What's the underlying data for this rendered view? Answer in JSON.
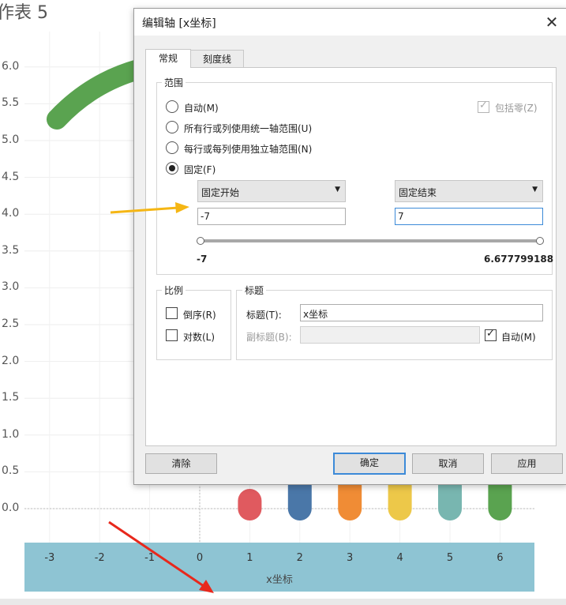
{
  "sheet": {
    "title": "作表 5"
  },
  "chart_data": {
    "type": "line",
    "y_ticks": [
      "6.0",
      "5.5",
      "5.0",
      "4.5",
      "4.0",
      "3.5",
      "3.0",
      "2.5",
      "2.0",
      "1.5",
      "1.0",
      "0.5",
      "0.0"
    ],
    "x_ticks": [
      "-3",
      "-2",
      "-1",
      "0",
      "1",
      "2",
      "3",
      "4",
      "5",
      "6"
    ],
    "xlabel": "x坐标",
    "x": [
      1,
      2,
      3,
      4,
      5,
      6
    ],
    "values": [
      0,
      0,
      0,
      0,
      0,
      0
    ],
    "colors": [
      "#e05a5f",
      "#4a77a8",
      "#f08c35",
      "#edc849",
      "#78b6b0",
      "#5aa350"
    ],
    "curve_color": "#5aa350",
    "axis_band_color": "#8ec4d3"
  },
  "dialog": {
    "title": "编辑轴 [x坐标]",
    "close_glyph": "✕",
    "tabs": [
      {
        "label": "常规",
        "active": true
      },
      {
        "label": "刻度线",
        "active": false
      }
    ],
    "range": {
      "group_label": "范围",
      "options": [
        {
          "label": "自动(M)",
          "selected": false
        },
        {
          "label": "所有行或列使用统一轴范围(U)",
          "selected": false
        },
        {
          "label": "每行或每列使用独立轴范围(N)",
          "selected": false
        },
        {
          "label": "固定(F)",
          "selected": true
        }
      ],
      "include_zero": {
        "label": "包括零(Z)",
        "checked": true,
        "disabled": true
      },
      "fixed_start": {
        "select_value": "固定开始",
        "value": "-7"
      },
      "fixed_end": {
        "select_value": "固定结束",
        "value": "7"
      },
      "slider_min_label": "-7",
      "slider_max_label": "6.677799188",
      "slider_low": 0.0,
      "slider_high": 1.0
    },
    "scale": {
      "group_label": "比例",
      "reverse": {
        "label": "倒序(R)",
        "checked": false
      },
      "log": {
        "label": "对数(L)",
        "checked": false
      }
    },
    "titles": {
      "group_label": "标题",
      "title_label": "标题(T):",
      "title_value": "x坐标",
      "subtitle_label": "副标题(B):",
      "subtitle_value": "",
      "auto": {
        "label": "自动(M)",
        "checked": true
      }
    },
    "buttons": {
      "clear": "清除",
      "ok": "确定",
      "cancel": "取消",
      "apply": "应用"
    }
  },
  "annotations": {
    "arrow_color_orange": "#f5b614",
    "arrow_color_red": "#e8281c"
  }
}
